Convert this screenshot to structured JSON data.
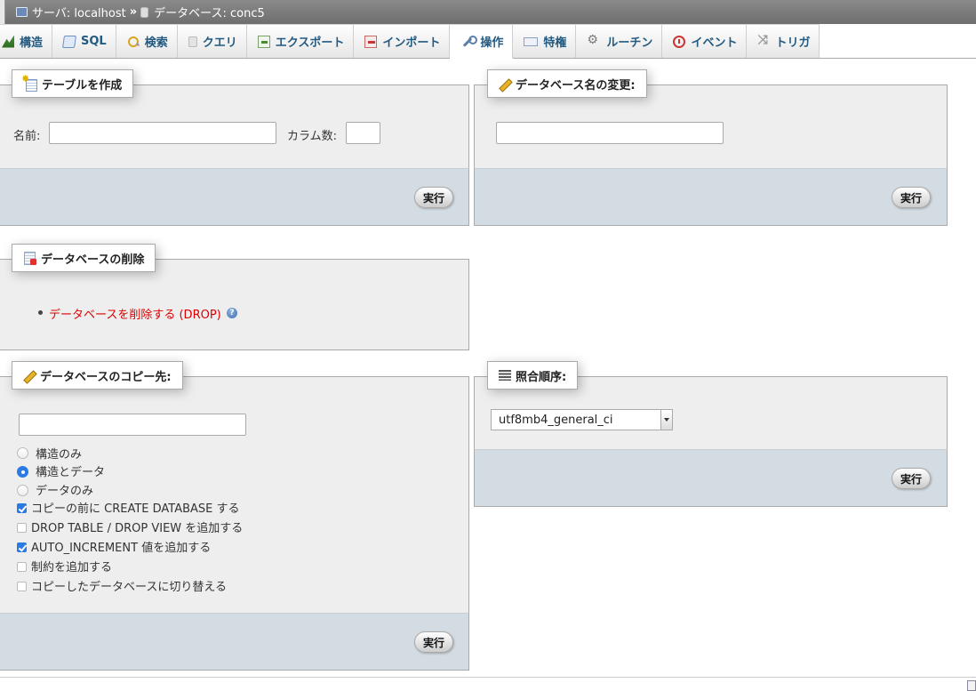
{
  "breadcrumb": {
    "server_label": "サーバ: localhost",
    "separator": "»",
    "database_label": "データベース: conc5"
  },
  "tabs": [
    {
      "label": "構造",
      "icon": "structure-icon"
    },
    {
      "label": "SQL",
      "icon": "sql-icon"
    },
    {
      "label": "検索",
      "icon": "search-icon"
    },
    {
      "label": "クエリ",
      "icon": "query-icon"
    },
    {
      "label": "エクスポート",
      "icon": "export-icon"
    },
    {
      "label": "インポート",
      "icon": "import-icon"
    },
    {
      "label": "操作",
      "icon": "wrench-icon",
      "active": true
    },
    {
      "label": "特権",
      "icon": "privileges-icon"
    },
    {
      "label": "ルーチン",
      "icon": "routines-icon"
    },
    {
      "label": "イベント",
      "icon": "events-icon"
    },
    {
      "label": "トリガ",
      "icon": "triggers-icon"
    }
  ],
  "create_table": {
    "legend": "テーブルを作成",
    "name_label": "名前:",
    "name_value": "",
    "columns_label": "カラム数:",
    "columns_value": "",
    "go_label": "実行"
  },
  "rename_db": {
    "legend": "データベース名の変更:",
    "value": "",
    "go_label": "実行"
  },
  "drop_db": {
    "legend": "データベースの削除",
    "link_label": "データベースを削除する (DROP)",
    "help_glyph": "?"
  },
  "copy_db": {
    "legend": "データベースのコピー先:",
    "value": "",
    "radios": [
      {
        "label": "構造のみ",
        "checked": false
      },
      {
        "label": "構造とデータ",
        "checked": true
      },
      {
        "label": "データのみ",
        "checked": false
      }
    ],
    "checkboxes": [
      {
        "label": "コピーの前に CREATE DATABASE する",
        "checked": true
      },
      {
        "label": "DROP TABLE / DROP VIEW を追加する",
        "checked": false
      },
      {
        "label": "AUTO_INCREMENT 値を追加する",
        "checked": true
      },
      {
        "label": "制約を追加する",
        "checked": false
      },
      {
        "label": "コピーしたデータベースに切り替える",
        "checked": false
      }
    ],
    "go_label": "実行"
  },
  "collation": {
    "legend": "照合順序:",
    "selected": "utf8mb4_general_ci",
    "go_label": "実行"
  },
  "colors": {
    "topbar": "#777777",
    "tab_text": "#235a81",
    "footer": "#d3dce3",
    "panel": "#eeeeee",
    "drop_link": "#dd0000",
    "accent_blue": "#2a7ae4"
  }
}
